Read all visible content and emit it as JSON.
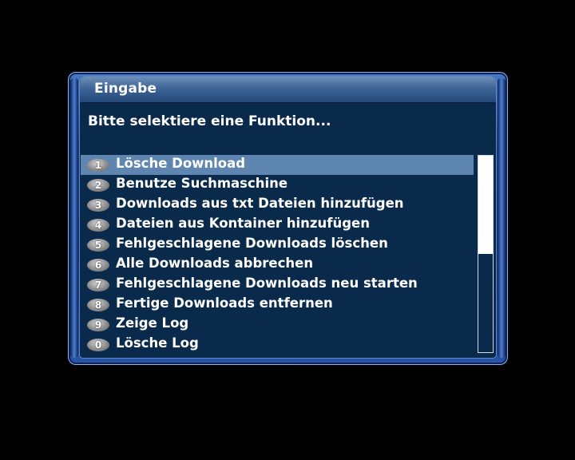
{
  "dialog": {
    "title": "Eingabe",
    "prompt": "Bitte selektiere eine Funktion...",
    "items": [
      {
        "key": "1",
        "label": "Lösche Download",
        "selected": true
      },
      {
        "key": "2",
        "label": "Benutze Suchmaschine",
        "selected": false
      },
      {
        "key": "3",
        "label": "Downloads aus txt Dateien hinzufügen",
        "selected": false
      },
      {
        "key": "4",
        "label": "Dateien aus Kontainer hinzufügen",
        "selected": false
      },
      {
        "key": "5",
        "label": "Fehlgeschlagene Downloads löschen",
        "selected": false
      },
      {
        "key": "6",
        "label": "Alle Downloads abbrechen",
        "selected": false
      },
      {
        "key": "7",
        "label": "Fehlgeschlagene Downloads neu starten",
        "selected": false
      },
      {
        "key": "8",
        "label": "Fertige Downloads entfernen",
        "selected": false
      },
      {
        "key": "9",
        "label": "Zeige Log",
        "selected": false
      },
      {
        "key": "0",
        "label": "Lösche Log",
        "selected": false
      }
    ],
    "scroll_position": 0.5
  },
  "colors": {
    "panel_bg": "#0a2a4c",
    "selection_bg": "#5f86b0",
    "text": "#ffffff"
  }
}
